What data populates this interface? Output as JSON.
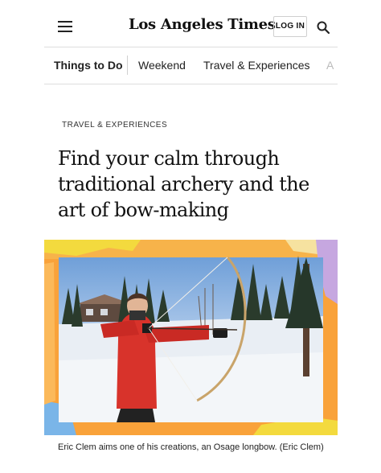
{
  "header": {
    "logo": "Los Angeles Times",
    "login_label": "LOG IN",
    "icons": {
      "menu": "hamburger-menu-icon",
      "search": "search-icon"
    }
  },
  "nav": {
    "items": [
      {
        "label": "Things to Do"
      },
      {
        "label": "Weekend"
      },
      {
        "label": "Travel & Experiences"
      },
      {
        "label": "A"
      }
    ]
  },
  "article": {
    "kicker": "TRAVEL & EXPERIENCES",
    "headline": "Find your calm through traditional archery and the art of bow-making",
    "caption": "Eric Clem aims one of his creations, an Osage longbow. (Eric Clem)"
  },
  "colors": {
    "frame_orange": "#f9a23a",
    "frame_yellow": "#f3da3e",
    "frame_purple": "#c6a7e0",
    "frame_blue": "#7ab5e8",
    "jacket_red": "#d8332b"
  }
}
